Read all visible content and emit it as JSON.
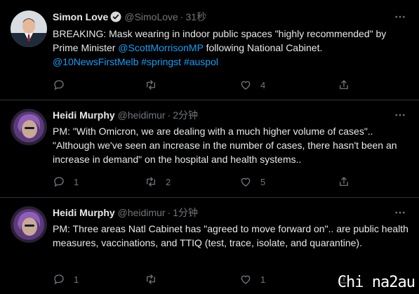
{
  "tweets": [
    {
      "name": "Simon Love",
      "handle": "@SimoLove",
      "time": "31秒",
      "verified": true,
      "avatar": "avatar-man-suit",
      "text_parts": [
        {
          "t": "BREAKING: Mask wearing in indoor public spaces \"highly recommended\" by Prime Minister ",
          "link": false
        },
        {
          "t": "@ScottMorrisonMP",
          "link": true
        },
        {
          "t": " following National Cabinet. ",
          "link": false
        },
        {
          "t": "@10NewsFirstMelb",
          "link": true
        },
        {
          "t": " ",
          "link": false
        },
        {
          "t": "#springst",
          "link": true
        },
        {
          "t": " ",
          "link": false
        },
        {
          "t": "#auspol",
          "link": true
        }
      ],
      "reply_count": "",
      "retweet_count": "",
      "like_count": "4"
    },
    {
      "name": "Heidi Murphy",
      "handle": "@heidimur",
      "time": "2分钟",
      "verified": false,
      "avatar": "avatar-woman-purple",
      "text_parts": [
        {
          "t": "PM: \"With Omicron, we are dealing with a much higher volume of cases\".. \"Although we've seen an increase in the number of cases, there hasn't been an increase in demand\" on the hospital and health systems..",
          "link": false
        }
      ],
      "reply_count": "1",
      "retweet_count": "2",
      "like_count": "5"
    },
    {
      "name": "Heidi Murphy",
      "handle": "@heidimur",
      "time": "1分钟",
      "verified": false,
      "avatar": "avatar-woman-purple",
      "text_parts": [
        {
          "t": "PM: Three areas Natl Cabinet has \"agreed to move forward on\".. are public health measures, vaccinations, and TTIQ (test, trace, isolate, and quarantine).",
          "link": false
        }
      ],
      "reply_count": "1",
      "retweet_count": "",
      "like_count": "1"
    }
  ],
  "watermark": "Chi na2au",
  "icons": [
    "verified-badge-icon",
    "more-icon",
    "reply-icon",
    "retweet-icon",
    "like-icon",
    "share-icon"
  ],
  "colors": {
    "background": "#000000",
    "text": "#e7e9ea",
    "muted": "#71767b",
    "link": "#1d9bf0",
    "divider": "#2f3336"
  }
}
